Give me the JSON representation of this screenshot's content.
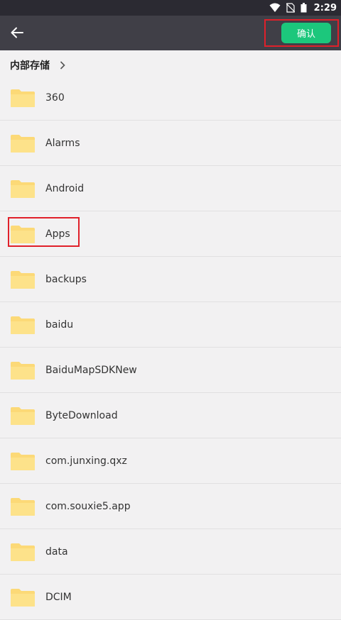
{
  "status": {
    "time": "2:29"
  },
  "toolbar": {
    "confirm_label": "确认"
  },
  "breadcrumb": {
    "label": "内部存储"
  },
  "folders": [
    {
      "name": "360"
    },
    {
      "name": "Alarms"
    },
    {
      "name": "Android"
    },
    {
      "name": "Apps"
    },
    {
      "name": "backups"
    },
    {
      "name": "baidu"
    },
    {
      "name": "BaiduMapSDKNew"
    },
    {
      "name": "ByteDownload"
    },
    {
      "name": "com.junxing.qxz"
    },
    {
      "name": "com.souxie5.app"
    },
    {
      "name": "data"
    },
    {
      "name": "DCIM"
    }
  ],
  "colors": {
    "accent": "#1cc77c",
    "folder": "#fde28a",
    "appbar": "#403f47",
    "statusbar": "#2b2a32",
    "highlight": "#e0202a"
  },
  "icons": {
    "back": "back-arrow-icon",
    "chevron": "chevron-right-icon",
    "folder": "folder-icon"
  }
}
